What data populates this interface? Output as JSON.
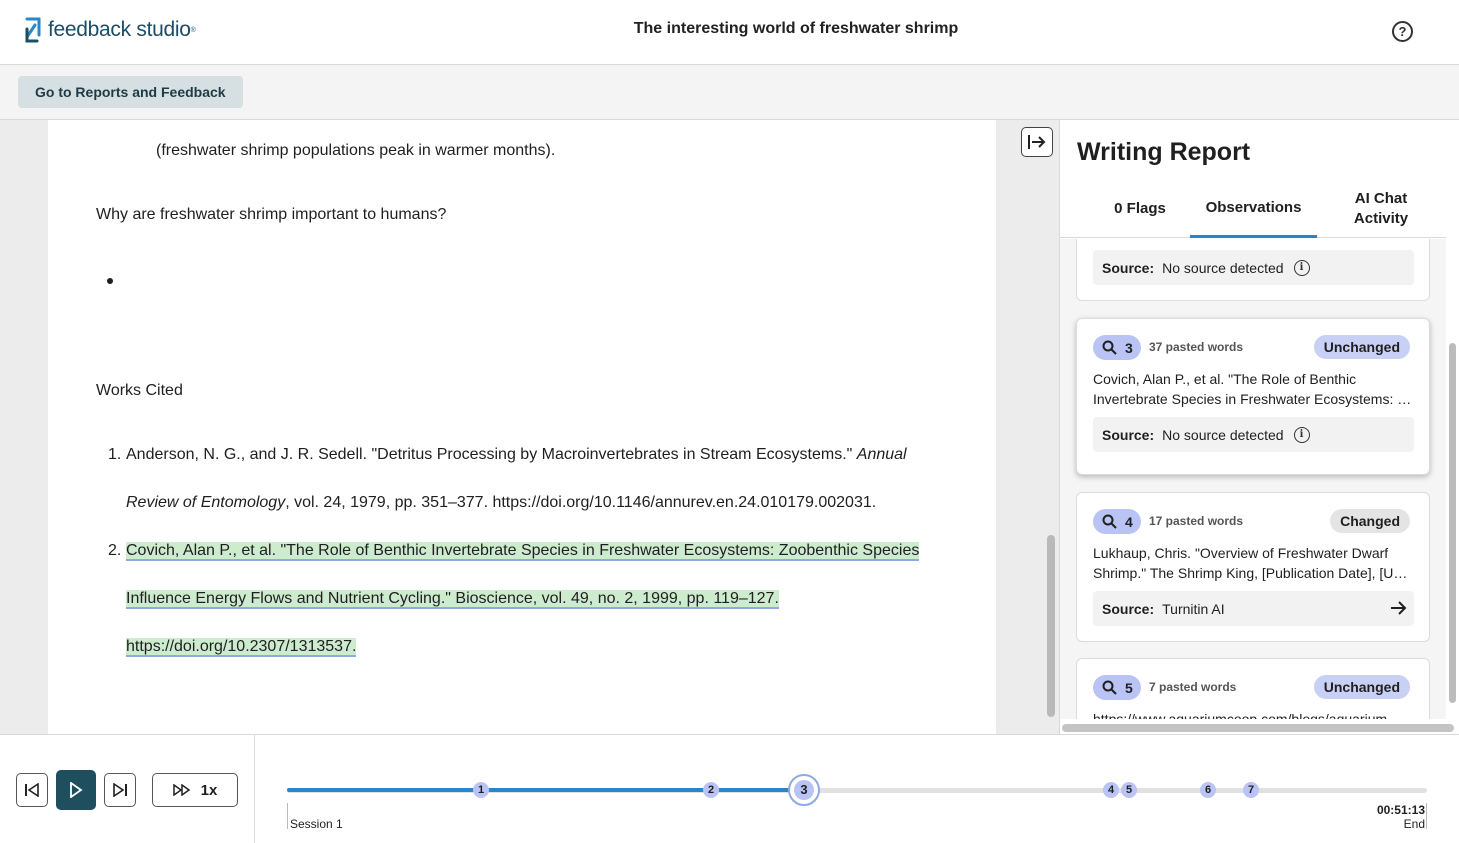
{
  "header": {
    "logo_text": "feedback studio",
    "logo_mark": "®",
    "doc_title": "The interesting world of freshwater shrimp"
  },
  "subbar": {
    "reports_button": "Go to Reports and Feedback"
  },
  "document": {
    "line_peak": "(freshwater shrimp populations peak in warmer months).",
    "question": "Why are freshwater shrimp important to humans?",
    "works_cited": "Works Cited",
    "citations": [
      {
        "num": "1.",
        "line1_plain": "Anderson, N. G., and J. R. Sedell. \"Detritus Processing by Macroinvertebrates in Stream Ecosystems.\" ",
        "line1_italic": "Annual",
        "line2_italic": "Review of Entomology",
        "line2_plain": ", vol. 24, 1979, pp. 351–377. https://doi.org/10.1146/annurev.en.24.010179.002031."
      },
      {
        "num": "2.",
        "line1": "Covich, Alan P., et al. \"The Role of Benthic Invertebrate Species in Freshwater Ecosystems: Zoobenthic Species",
        "line2": "Influence Energy Flows and Nutrient Cycling.\" Bioscience, vol. 49, no. 2, 1999, pp. 119–127.",
        "line3": "https://doi.org/10.2307/1313537."
      }
    ]
  },
  "panel": {
    "title": "Writing Report",
    "tabs": [
      {
        "label": "0 Flags",
        "active": false
      },
      {
        "label": "Observations",
        "active": true
      },
      {
        "label": "AI Chat Activity",
        "active": false
      }
    ],
    "source_label": "Source:",
    "cards": [
      {
        "source": "No source detected",
        "source_icon": "info-icon"
      },
      {
        "num": "3",
        "pasted": "37 pasted words",
        "status": "Unchanged",
        "excerpt1": "Covich, Alan P., et al. \"The Role of Benthic",
        "excerpt2": "Invertebrate Species in Freshwater Ecosystems: Zoobenthic",
        "source": "No source detected",
        "source_icon": "info-icon"
      },
      {
        "num": "4",
        "pasted": "17 pasted words",
        "status": "Changed",
        "excerpt1": "Lukhaup, Chris. \"Overview of Freshwater Dwarf",
        "excerpt2": "Shrimp.\" The Shrimp King, [Publication Date], [URL].",
        "source": "Turnitin AI",
        "source_icon": "arrow-right-icon"
      },
      {
        "num": "5",
        "pasted": "7 pasted words",
        "status": "Unchanged",
        "excerpt1": "https://www.aquariumcoop.com/blogs/aquarium"
      }
    ]
  },
  "player": {
    "speed": "1x",
    "session_label": "Session 1",
    "end_time": "00:51:13",
    "end_label": "End",
    "markers": [
      "1",
      "2",
      "3",
      "4",
      "5",
      "6",
      "7"
    ],
    "current_marker": "3"
  }
}
